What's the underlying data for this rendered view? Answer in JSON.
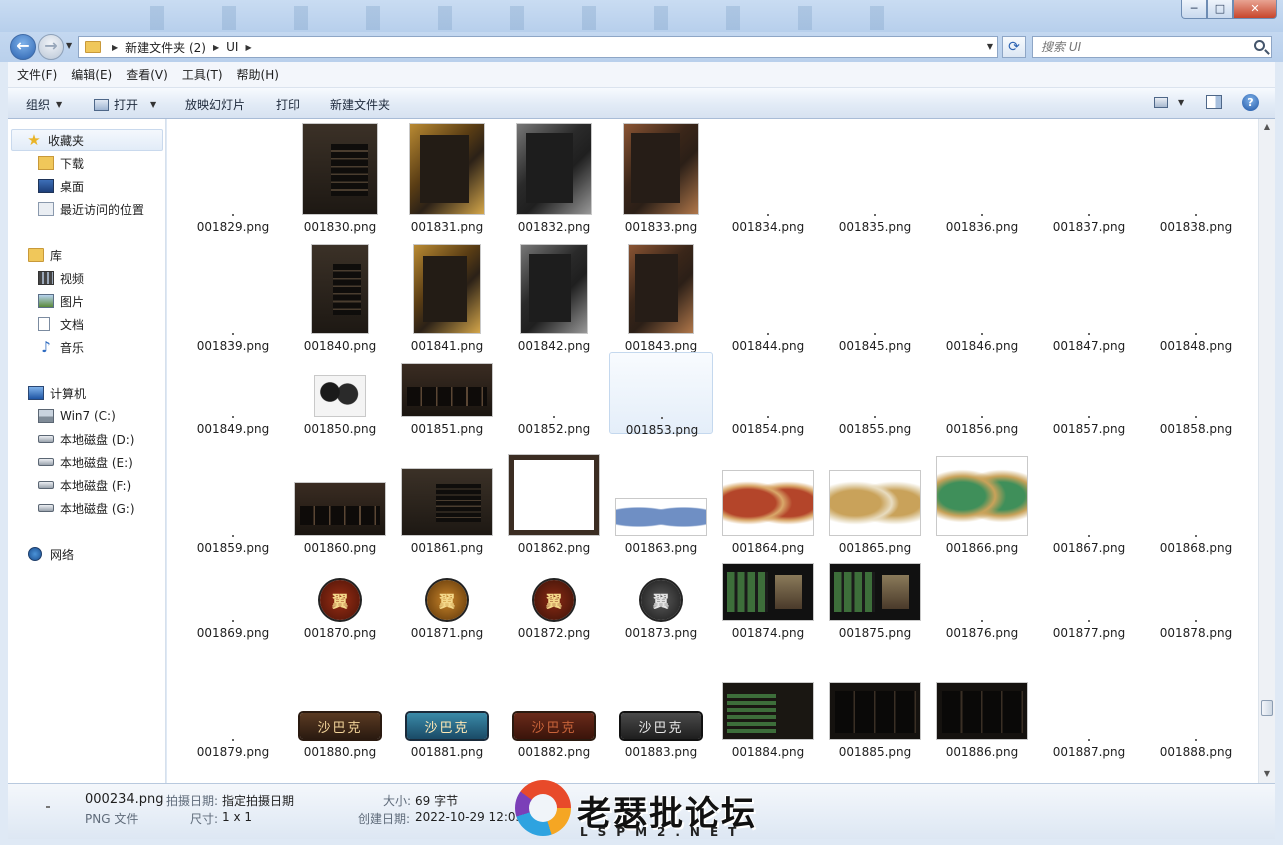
{
  "window": {
    "minimize_label": "─",
    "maximize_label": "□",
    "close_label": "✕"
  },
  "address": {
    "crumbs": [
      "新建文件夹 (2)",
      "UI"
    ],
    "search_placeholder": "搜索 UI"
  },
  "menu": [
    "文件(F)",
    "编辑(E)",
    "查看(V)",
    "工具(T)",
    "帮助(H)"
  ],
  "toolbar": {
    "organize": "组织",
    "open": "打开",
    "slideshow": "放映幻灯片",
    "print": "打印",
    "new_folder": "新建文件夹",
    "help": "?"
  },
  "sidebar": {
    "favorites": "收藏夹",
    "downloads": "下载",
    "desktop": "桌面",
    "recent": "最近访问的位置",
    "libraries": "库",
    "videos": "视频",
    "pictures": "图片",
    "documents": "文档",
    "music": "音乐",
    "computer": "计算机",
    "drives": [
      "Win7 (C:)",
      "本地磁盘 (D:)",
      "本地磁盘 (E:)",
      "本地磁盘 (F:)",
      "本地磁盘 (G:)"
    ],
    "network": "网络"
  },
  "files": [
    "001829.png",
    "001830.png",
    "001831.png",
    "001832.png",
    "001833.png",
    "001834.png",
    "001835.png",
    "001836.png",
    "001837.png",
    "001838.png",
    "001839.png",
    "001840.png",
    "001841.png",
    "001842.png",
    "001843.png",
    "001844.png",
    "001845.png",
    "001846.png",
    "001847.png",
    "001848.png",
    "001849.png",
    "001850.png",
    "001851.png",
    "001852.png",
    "001853.png",
    "001854.png",
    "001855.png",
    "001856.png",
    "001857.png",
    "001858.png",
    "001859.png",
    "001860.png",
    "001861.png",
    "001862.png",
    "001863.png",
    "001864.png",
    "001865.png",
    "001866.png",
    "001867.png",
    "001868.png",
    "001869.png",
    "001870.png",
    "001871.png",
    "001872.png",
    "001873.png",
    "001874.png",
    "001875.png",
    "001876.png",
    "001877.png",
    "001878.png",
    "001879.png",
    "001880.png",
    "001881.png",
    "001882.png",
    "001883.png",
    "001884.png",
    "001885.png",
    "001886.png",
    "001887.png",
    "001888.png"
  ],
  "selected_file": "001853.png",
  "thumb_glyphs": {
    "coin": "翼",
    "button": "沙巴克"
  },
  "details": {
    "name": "000234.png",
    "type": "PNG 文件",
    "date_taken_label": "拍摄日期:",
    "date_taken_value": "指定拍摄日期",
    "dimensions_label": "尺寸:",
    "dimensions_value": "1 x 1",
    "size_label": "大小:",
    "size_value": "69 字节",
    "created_label": "创建日期:",
    "created_value": "2022-10-29 12:05"
  },
  "watermark": {
    "title": "老瑟批论坛",
    "subtitle": "LSPM2.NET"
  }
}
